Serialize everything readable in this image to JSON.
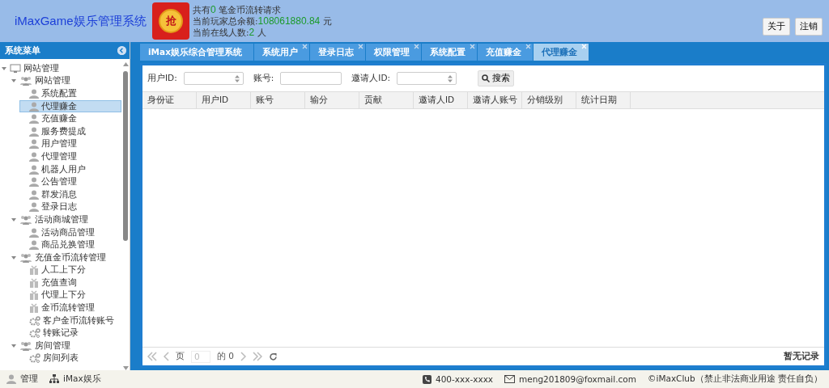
{
  "header": {
    "title": "iMaxGame娱乐管理系统",
    "logo_char": "抢",
    "stats": [
      {
        "prefix": "共有",
        "value": "0",
        "suffix": "笔金币流转请求"
      },
      {
        "prefix": "当前玩家总余额:",
        "value": "108061880.84",
        "suffix": "元"
      },
      {
        "prefix": "当前在线人数:",
        "value": "2",
        "suffix": "人"
      }
    ],
    "buttons": [
      "关于",
      "注销"
    ]
  },
  "sidebar": {
    "title": "系统菜单",
    "tree": [
      {
        "label": "网站管理",
        "kind": "monitor",
        "expanded": true,
        "selected": false,
        "children": [
          {
            "label": "网站管理",
            "kind": "group",
            "expanded": true,
            "selected": false,
            "children": [
              {
                "label": "系统配置",
                "kind": "user",
                "selected": false
              },
              {
                "label": "代理赚金",
                "kind": "user",
                "selected": true
              },
              {
                "label": "充值赚金",
                "kind": "user",
                "selected": false
              },
              {
                "label": "服务费提成",
                "kind": "user",
                "selected": false
              },
              {
                "label": "用户管理",
                "kind": "user",
                "selected": false
              },
              {
                "label": "代理管理",
                "kind": "user",
                "selected": false
              },
              {
                "label": "机器人用户",
                "kind": "user",
                "selected": false
              },
              {
                "label": "公告管理",
                "kind": "user",
                "selected": false
              },
              {
                "label": "群发消息",
                "kind": "user",
                "selected": false
              },
              {
                "label": "登录日志",
                "kind": "user",
                "selected": false
              }
            ]
          },
          {
            "label": "活动商城管理",
            "kind": "group",
            "expanded": true,
            "selected": false,
            "children": [
              {
                "label": "活动商品管理",
                "kind": "user",
                "selected": false
              },
              {
                "label": "商品兑换管理",
                "kind": "user",
                "selected": false
              }
            ]
          },
          {
            "label": "充值金币流转管理",
            "kind": "group",
            "expanded": true,
            "selected": false,
            "children": [
              {
                "label": "人工上下分",
                "kind": "gift",
                "selected": false
              },
              {
                "label": "充值查询",
                "kind": "gift",
                "selected": false
              },
              {
                "label": "代理上下分",
                "kind": "gift",
                "selected": false
              },
              {
                "label": "金币流转管理",
                "kind": "gift",
                "selected": false
              },
              {
                "label": "客户金币流转账号",
                "kind": "gears",
                "selected": false
              },
              {
                "label": "转账记录",
                "kind": "gears",
                "selected": false
              }
            ]
          },
          {
            "label": "房间管理",
            "kind": "group",
            "expanded": true,
            "selected": false,
            "children": [
              {
                "label": "房间列表",
                "kind": "gears",
                "selected": false
              }
            ]
          }
        ]
      }
    ]
  },
  "tabs": [
    {
      "label": "iMax娱乐综合管理系统",
      "closable": false,
      "selected": false
    },
    {
      "label": "系统用户",
      "closable": true,
      "selected": false
    },
    {
      "label": "登录日志",
      "closable": true,
      "selected": false
    },
    {
      "label": "权限管理",
      "closable": true,
      "selected": false
    },
    {
      "label": "系统配置",
      "closable": true,
      "selected": false
    },
    {
      "label": "充值赚金",
      "closable": true,
      "selected": false
    },
    {
      "label": "代理赚金",
      "closable": true,
      "selected": true
    }
  ],
  "filters": [
    {
      "label": "用户ID:",
      "kind": "spinner"
    },
    {
      "label": "账号:",
      "kind": "text"
    },
    {
      "label": "邀请人ID:",
      "kind": "spinner"
    }
  ],
  "search_button": "搜索",
  "table": {
    "columns": [
      "身份证",
      "用户ID",
      "账号",
      "输分",
      "贡献",
      "邀请人ID",
      "邀请人账号",
      "分销级别",
      "统计日期"
    ]
  },
  "pager": {
    "page_label": "页",
    "page_value": "0",
    "of_label": "的 0",
    "status": "暂无记录"
  },
  "footer": {
    "left": [
      {
        "label": "管理",
        "kind": "user"
      },
      {
        "label": "iMax娱乐",
        "kind": "sitemap"
      }
    ],
    "right": [
      {
        "label": "400-xxx-xxxx",
        "kind": "phone"
      },
      {
        "label": "meng201809@foxmail.com",
        "kind": "mail"
      },
      {
        "label": "©iMaxClub（禁止非法商业用途 责任自负）",
        "kind": "plain"
      }
    ]
  }
}
